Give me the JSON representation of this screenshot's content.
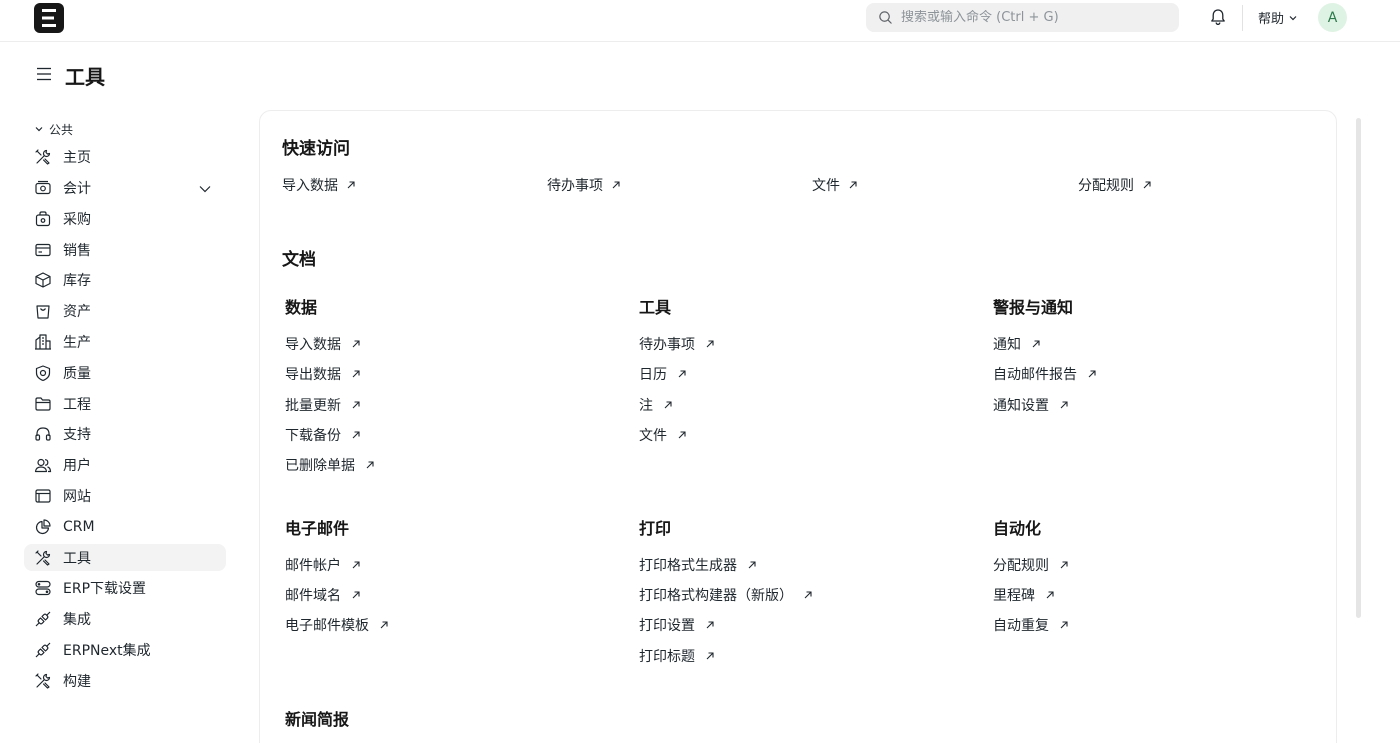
{
  "app": {
    "logo_letter": "E"
  },
  "search": {
    "placeholder": "搜索或输入命令 (Ctrl + G)"
  },
  "navbar": {
    "help_label": "帮助",
    "avatar_letter": "A"
  },
  "page": {
    "title": "工具"
  },
  "sidebar": {
    "section_label": "公共",
    "items": [
      {
        "label": "主页",
        "icon": "tools-icon"
      },
      {
        "label": "会计",
        "icon": "accounting-icon"
      },
      {
        "label": "采购",
        "icon": "buying-icon"
      },
      {
        "label": "销售",
        "icon": "selling-icon"
      },
      {
        "label": "库存",
        "icon": "stock-icon"
      },
      {
        "label": "资产",
        "icon": "assets-icon"
      },
      {
        "label": "生产",
        "icon": "manufacturing-icon"
      },
      {
        "label": "质量",
        "icon": "quality-icon"
      },
      {
        "label": "工程",
        "icon": "projects-icon"
      },
      {
        "label": "支持",
        "icon": "support-icon"
      },
      {
        "label": "用户",
        "icon": "users-icon"
      },
      {
        "label": "网站",
        "icon": "website-icon"
      },
      {
        "label": "CRM",
        "icon": "crm-icon"
      },
      {
        "label": "工具",
        "icon": "tools-icon"
      },
      {
        "label": "ERP下载设置",
        "icon": "settings-icon"
      },
      {
        "label": "集成",
        "icon": "integrations-icon"
      },
      {
        "label": "ERPNext集成",
        "icon": "integrations-icon"
      },
      {
        "label": "构建",
        "icon": "build-icon"
      }
    ]
  },
  "quick_access": {
    "title": "快速访问",
    "links": [
      "导入数据",
      "待办事项",
      "文件",
      "分配规则"
    ]
  },
  "documents": {
    "title": "文档",
    "groups": [
      {
        "title": "数据",
        "links": [
          "导入数据",
          "导出数据",
          "批量更新",
          "下载备份",
          "已删除单据"
        ]
      },
      {
        "title": "工具",
        "links": [
          "待办事项",
          "日历",
          "注",
          "文件"
        ]
      },
      {
        "title": "警报与通知",
        "links": [
          "通知",
          "自动邮件报告",
          "通知设置"
        ]
      },
      {
        "title": "电子邮件",
        "links": [
          "邮件帐户",
          "邮件域名",
          "电子邮件模板"
        ]
      },
      {
        "title": "打印",
        "links": [
          "打印格式生成器",
          "打印格式构建器（新版）",
          "打印设置",
          "打印标题"
        ]
      },
      {
        "title": "自动化",
        "links": [
          "分配规则",
          "里程碑",
          "自动重复"
        ]
      },
      {
        "title": "新闻简报",
        "links": []
      }
    ]
  }
}
